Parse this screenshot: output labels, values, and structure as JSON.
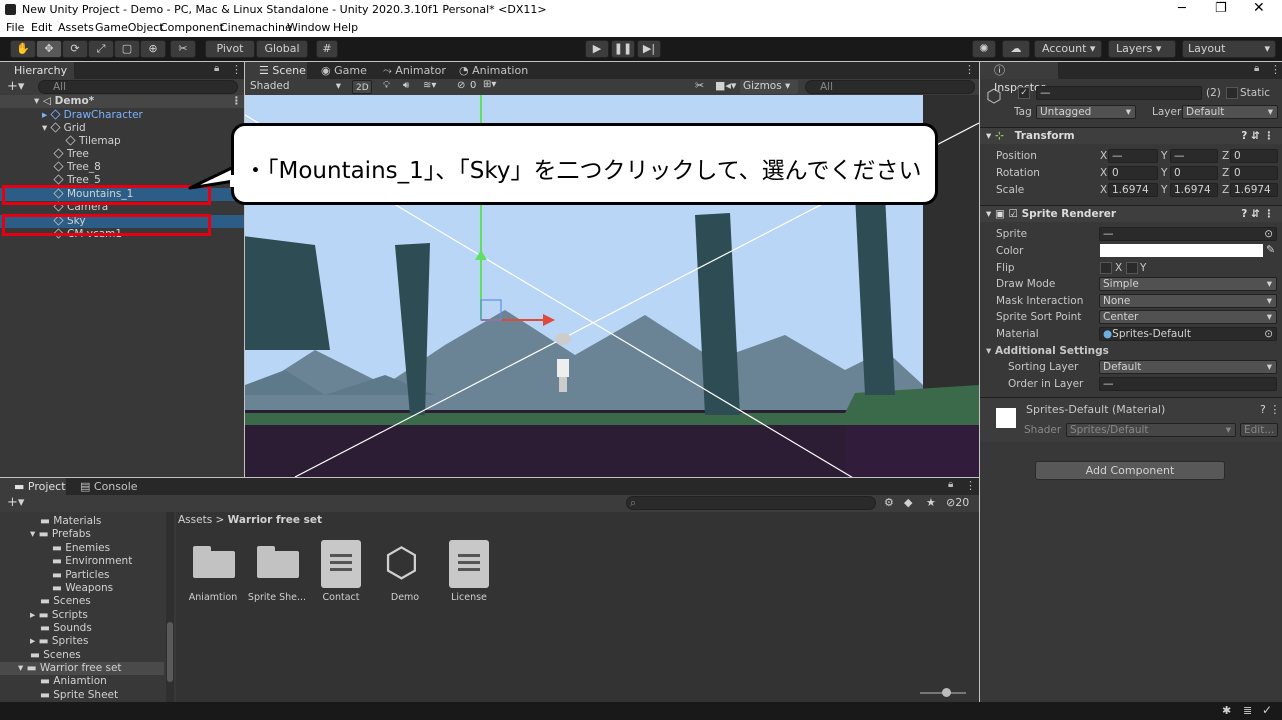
{
  "window": {
    "title": "New Unity Project - Demo - PC, Mac & Linux Standalone - Unity 2020.3.10f1 Personal* <DX11>"
  },
  "menu": [
    "File",
    "Edit",
    "Assets",
    "GameObject",
    "Component",
    "Cinemachine",
    "Window",
    "Help"
  ],
  "toolbar": {
    "pivot": "Pivot",
    "global": "Global",
    "account": "Account",
    "layers": "Layers",
    "layout": "Layout"
  },
  "hierarchy": {
    "tab": "Hierarchy",
    "search_placeholder": "All",
    "items": [
      {
        "label": "Demo*"
      },
      {
        "label": "DrawCharacter"
      },
      {
        "label": "Grid"
      },
      {
        "label": "Tilemap"
      },
      {
        "label": "Tree"
      },
      {
        "label": "Tree_8"
      },
      {
        "label": "Tree_5"
      },
      {
        "label": "Mountains_1"
      },
      {
        "label": "Camera"
      },
      {
        "label": "Sky"
      },
      {
        "label": "CM vcam1"
      }
    ]
  },
  "scene": {
    "tabs": [
      "Scene",
      "Game",
      "Animator",
      "Animation"
    ],
    "shading": "Shaded",
    "mode_2d": "2D",
    "hidden_count": "0",
    "gizmos": "Gizmos",
    "search_placeholder": "All"
  },
  "callout": {
    "text": "・「Mountains_1」、「Sky」を二つクリックして、選んでください"
  },
  "inspector": {
    "tab": "Inspector",
    "name_value": "—",
    "count": "(2)",
    "static": "Static",
    "tag_label": "Tag",
    "tag_value": "Untagged",
    "layer_label": "Layer",
    "layer_value": "Default",
    "transform": {
      "title": "Transform",
      "position": {
        "label": "Position",
        "x": "—",
        "y": "—",
        "z": "0"
      },
      "rotation": {
        "label": "Rotation",
        "x": "0",
        "y": "0",
        "z": "0"
      },
      "scale": {
        "label": "Scale",
        "x": "1.6974",
        "y": "1.6974",
        "z": "1.6974"
      }
    },
    "sprite_renderer": {
      "title": "Sprite Renderer",
      "sprite": {
        "label": "Sprite",
        "value": "—"
      },
      "color": {
        "label": "Color",
        "value": "#ffffff"
      },
      "flip": {
        "label": "Flip",
        "x": "X",
        "y": "Y"
      },
      "draw_mode": {
        "label": "Draw Mode",
        "value": "Simple"
      },
      "mask": {
        "label": "Mask Interaction",
        "value": "None"
      },
      "sort_point": {
        "label": "Sprite Sort Point",
        "value": "Center"
      },
      "material": {
        "label": "Material",
        "value": "Sprites-Default"
      },
      "additional": "Additional Settings",
      "sorting_layer": {
        "label": "Sorting Layer",
        "value": "Default"
      },
      "order": {
        "label": "Order in Layer",
        "value": "—"
      }
    },
    "material_block": {
      "title": "Sprites-Default (Material)",
      "shader_label": "Shader",
      "shader_value": "Sprites/Default",
      "edit": "Edit..."
    },
    "add_component": "Add Component"
  },
  "project": {
    "tabs": [
      "Project",
      "Console"
    ],
    "badge": "20",
    "tree": [
      {
        "label": "Materials"
      },
      {
        "label": "Prefabs"
      },
      {
        "label": "Enemies"
      },
      {
        "label": "Environment"
      },
      {
        "label": "Particles"
      },
      {
        "label": "Weapons"
      },
      {
        "label": "Scenes"
      },
      {
        "label": "Scripts"
      },
      {
        "label": "Sounds"
      },
      {
        "label": "Sprites"
      },
      {
        "label": "Scenes"
      },
      {
        "label": "Warrior free set"
      },
      {
        "label": "Aniamtion"
      },
      {
        "label": "Sprite Sheet"
      }
    ],
    "breadcrumb": {
      "root": "Assets",
      "sep": ">",
      "current": "Warrior free set"
    },
    "assets": [
      {
        "label": "Aniamtion"
      },
      {
        "label": "Sprite She..."
      },
      {
        "label": "Contact"
      },
      {
        "label": "Demo"
      },
      {
        "label": "License"
      }
    ]
  }
}
